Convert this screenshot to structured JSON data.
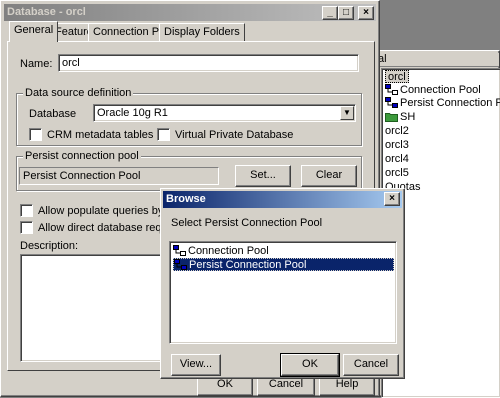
{
  "right_panel": {
    "header": "al",
    "items": [
      {
        "label": "orcl",
        "icon": "none"
      },
      {
        "label": "Connection Pool",
        "icon": "connection-pool-icon"
      },
      {
        "label": "Persist Connection Pool",
        "icon": "persist-connection-pool-icon"
      },
      {
        "label": "SH",
        "icon": "folder-icon"
      },
      {
        "label": "orcl2",
        "icon": "none"
      },
      {
        "label": "orcl3",
        "icon": "none"
      },
      {
        "label": "orcl4",
        "icon": "none"
      },
      {
        "label": "orcl5",
        "icon": "none"
      },
      {
        "label": "Quotas",
        "icon": "none"
      }
    ]
  },
  "database_dialog": {
    "title": "Database - orcl",
    "tabs": [
      "General",
      "Features",
      "Connection Pools",
      "Display Folders"
    ],
    "active_tab": "General",
    "name_label": "Name:",
    "name_value": "orcl",
    "datasource_group": "Data source definition",
    "database_label": "Database",
    "database_value": "Oracle 10g R1",
    "crm_label": "CRM metadata tables",
    "vpd_label": "Virtual Private Database",
    "persist_group": "Persist connection pool",
    "persist_value": "Persist Connection Pool",
    "set_button": "Set...",
    "clear_button": "Clear",
    "allow_populate": "Allow populate queries by default",
    "allow_direct": "Allow direct database requests by d",
    "description_label": "Description:",
    "ok_button": "OK",
    "cancel_button": "Cancel",
    "help_button": "Help"
  },
  "browse_dialog": {
    "title": "Browse",
    "prompt": "Select Persist Connection Pool",
    "items": [
      {
        "label": "Connection Pool",
        "selected": false
      },
      {
        "label": "Persist Connection Pool",
        "selected": true
      }
    ],
    "view_button": "View...",
    "ok_button": "OK",
    "cancel_button": "Cancel"
  },
  "colors": {
    "selection": "#0a246a",
    "face": "#d4d0c8",
    "active_title": "#0a246a",
    "inactive_title": "#808080"
  }
}
